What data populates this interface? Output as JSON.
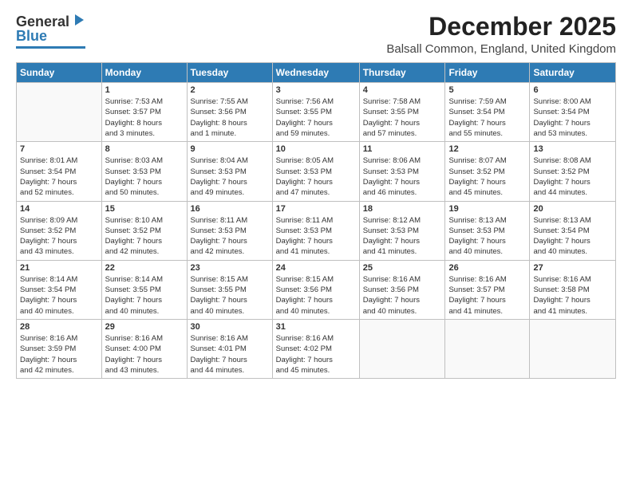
{
  "header": {
    "logo_general": "General",
    "logo_blue": "Blue",
    "month_title": "December 2025",
    "location": "Balsall Common, England, United Kingdom"
  },
  "weekdays": [
    "Sunday",
    "Monday",
    "Tuesday",
    "Wednesday",
    "Thursday",
    "Friday",
    "Saturday"
  ],
  "weeks": [
    [
      {
        "day": "",
        "info": ""
      },
      {
        "day": "1",
        "info": "Sunrise: 7:53 AM\nSunset: 3:57 PM\nDaylight: 8 hours\nand 3 minutes."
      },
      {
        "day": "2",
        "info": "Sunrise: 7:55 AM\nSunset: 3:56 PM\nDaylight: 8 hours\nand 1 minute."
      },
      {
        "day": "3",
        "info": "Sunrise: 7:56 AM\nSunset: 3:55 PM\nDaylight: 7 hours\nand 59 minutes."
      },
      {
        "day": "4",
        "info": "Sunrise: 7:58 AM\nSunset: 3:55 PM\nDaylight: 7 hours\nand 57 minutes."
      },
      {
        "day": "5",
        "info": "Sunrise: 7:59 AM\nSunset: 3:54 PM\nDaylight: 7 hours\nand 55 minutes."
      },
      {
        "day": "6",
        "info": "Sunrise: 8:00 AM\nSunset: 3:54 PM\nDaylight: 7 hours\nand 53 minutes."
      }
    ],
    [
      {
        "day": "7",
        "info": "Sunrise: 8:01 AM\nSunset: 3:54 PM\nDaylight: 7 hours\nand 52 minutes."
      },
      {
        "day": "8",
        "info": "Sunrise: 8:03 AM\nSunset: 3:53 PM\nDaylight: 7 hours\nand 50 minutes."
      },
      {
        "day": "9",
        "info": "Sunrise: 8:04 AM\nSunset: 3:53 PM\nDaylight: 7 hours\nand 49 minutes."
      },
      {
        "day": "10",
        "info": "Sunrise: 8:05 AM\nSunset: 3:53 PM\nDaylight: 7 hours\nand 47 minutes."
      },
      {
        "day": "11",
        "info": "Sunrise: 8:06 AM\nSunset: 3:53 PM\nDaylight: 7 hours\nand 46 minutes."
      },
      {
        "day": "12",
        "info": "Sunrise: 8:07 AM\nSunset: 3:52 PM\nDaylight: 7 hours\nand 45 minutes."
      },
      {
        "day": "13",
        "info": "Sunrise: 8:08 AM\nSunset: 3:52 PM\nDaylight: 7 hours\nand 44 minutes."
      }
    ],
    [
      {
        "day": "14",
        "info": "Sunrise: 8:09 AM\nSunset: 3:52 PM\nDaylight: 7 hours\nand 43 minutes."
      },
      {
        "day": "15",
        "info": "Sunrise: 8:10 AM\nSunset: 3:52 PM\nDaylight: 7 hours\nand 42 minutes."
      },
      {
        "day": "16",
        "info": "Sunrise: 8:11 AM\nSunset: 3:53 PM\nDaylight: 7 hours\nand 42 minutes."
      },
      {
        "day": "17",
        "info": "Sunrise: 8:11 AM\nSunset: 3:53 PM\nDaylight: 7 hours\nand 41 minutes."
      },
      {
        "day": "18",
        "info": "Sunrise: 8:12 AM\nSunset: 3:53 PM\nDaylight: 7 hours\nand 41 minutes."
      },
      {
        "day": "19",
        "info": "Sunrise: 8:13 AM\nSunset: 3:53 PM\nDaylight: 7 hours\nand 40 minutes."
      },
      {
        "day": "20",
        "info": "Sunrise: 8:13 AM\nSunset: 3:54 PM\nDaylight: 7 hours\nand 40 minutes."
      }
    ],
    [
      {
        "day": "21",
        "info": "Sunrise: 8:14 AM\nSunset: 3:54 PM\nDaylight: 7 hours\nand 40 minutes."
      },
      {
        "day": "22",
        "info": "Sunrise: 8:14 AM\nSunset: 3:55 PM\nDaylight: 7 hours\nand 40 minutes."
      },
      {
        "day": "23",
        "info": "Sunrise: 8:15 AM\nSunset: 3:55 PM\nDaylight: 7 hours\nand 40 minutes."
      },
      {
        "day": "24",
        "info": "Sunrise: 8:15 AM\nSunset: 3:56 PM\nDaylight: 7 hours\nand 40 minutes."
      },
      {
        "day": "25",
        "info": "Sunrise: 8:16 AM\nSunset: 3:56 PM\nDaylight: 7 hours\nand 40 minutes."
      },
      {
        "day": "26",
        "info": "Sunrise: 8:16 AM\nSunset: 3:57 PM\nDaylight: 7 hours\nand 41 minutes."
      },
      {
        "day": "27",
        "info": "Sunrise: 8:16 AM\nSunset: 3:58 PM\nDaylight: 7 hours\nand 41 minutes."
      }
    ],
    [
      {
        "day": "28",
        "info": "Sunrise: 8:16 AM\nSunset: 3:59 PM\nDaylight: 7 hours\nand 42 minutes."
      },
      {
        "day": "29",
        "info": "Sunrise: 8:16 AM\nSunset: 4:00 PM\nDaylight: 7 hours\nand 43 minutes."
      },
      {
        "day": "30",
        "info": "Sunrise: 8:16 AM\nSunset: 4:01 PM\nDaylight: 7 hours\nand 44 minutes."
      },
      {
        "day": "31",
        "info": "Sunrise: 8:16 AM\nSunset: 4:02 PM\nDaylight: 7 hours\nand 45 minutes."
      },
      {
        "day": "",
        "info": ""
      },
      {
        "day": "",
        "info": ""
      },
      {
        "day": "",
        "info": ""
      }
    ]
  ]
}
